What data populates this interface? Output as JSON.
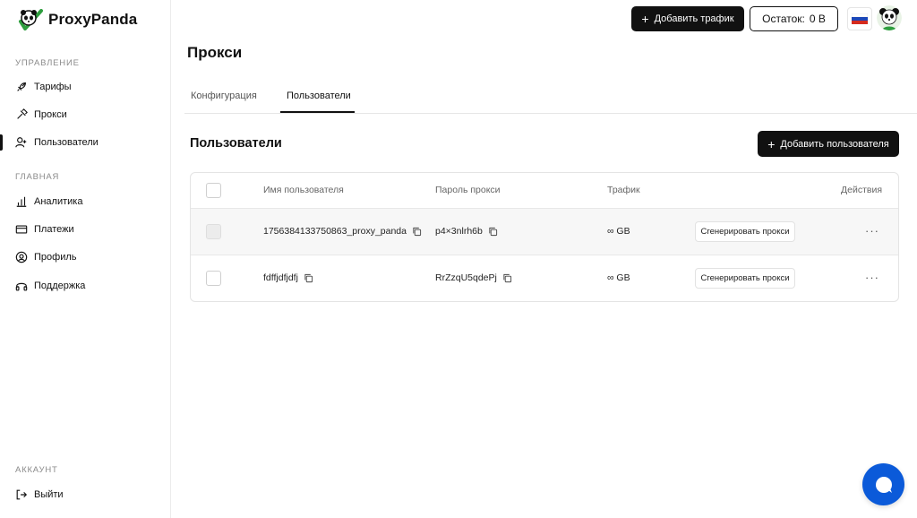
{
  "app": {
    "name": "ProxyPanda"
  },
  "sidebar": {
    "section_manage": "УПРАВЛЕНИЕ",
    "section_main": "ГЛАВНАЯ",
    "section_account": "АККАУНТ",
    "items": {
      "tariffs": "Тарифы",
      "proxies": "Прокси",
      "users": "Пользователи",
      "analytics": "Аналитика",
      "payments": "Платежи",
      "profile": "Профиль",
      "support": "Поддержка",
      "logout": "Выйти"
    }
  },
  "header": {
    "add_traffic": "Добавить трафик",
    "balance_label": "Остаток:",
    "balance_value": "0 B",
    "language": "ru"
  },
  "page": {
    "title": "Прокси",
    "tabs": [
      "Конфигурация",
      "Пользователи"
    ],
    "active_tab": "Пользователи",
    "section_title": "Пользователи",
    "add_user": "Добавить пользователя"
  },
  "table": {
    "headers": {
      "username": "Имя пользователя",
      "password": "Пароль прокси",
      "traffic": "Трафик",
      "actions": "Действия"
    },
    "rows": [
      {
        "username": "1756384133750863_proxy_panda",
        "password": "p4×3nlrh6b",
        "traffic": "∞ GB",
        "action": "Сгенерировать прокси",
        "more": "···"
      },
      {
        "username": "fdffjdfjdfj",
        "password": "RrZzqU5qdePj",
        "traffic": "∞ GB",
        "action": "Сгенерировать прокси",
        "more": "···"
      }
    ]
  },
  "colors": {
    "primary": "#111111",
    "accent": "#0b5ad9",
    "logo_green": "#2e9e3e"
  }
}
